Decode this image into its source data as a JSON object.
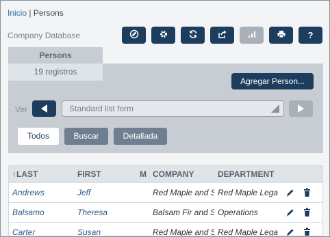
{
  "breadcrumb": {
    "home": "Inicio",
    "separator": "|",
    "current": "Persons"
  },
  "db_label": "Company Database",
  "toolbar": [
    {
      "name": "tool-button-1",
      "icon": "palette-icon",
      "disabled": false
    },
    {
      "name": "settings-button",
      "icon": "gear-icon",
      "disabled": false
    },
    {
      "name": "refresh-button",
      "icon": "refresh-icon",
      "disabled": false
    },
    {
      "name": "export-button",
      "icon": "share-icon",
      "disabled": false
    },
    {
      "name": "chart-button",
      "icon": "bar-chart-icon",
      "disabled": true
    },
    {
      "name": "print-button",
      "icon": "printer-icon",
      "disabled": false
    },
    {
      "name": "help-button",
      "icon": "question-icon",
      "label": "?",
      "disabled": false
    }
  ],
  "tab": {
    "label": "Persons",
    "count": "19 registros"
  },
  "add_button": "Agregar Person...",
  "view": {
    "label": "Ver",
    "form": "Standard list form"
  },
  "segments": [
    "Todos",
    "Buscar",
    "Detallada"
  ],
  "table": {
    "headers": [
      "↑LAST",
      "FIRST",
      "M",
      "COMPANY",
      "DEPARTMENT"
    ],
    "rows": [
      {
        "last": "Andrews",
        "first": "Jeff",
        "m": "",
        "company": "Red Maple and S",
        "department": "Red Maple Lega"
      },
      {
        "last": "Balsamo",
        "first": "Theresa",
        "m": "",
        "company": "Balsam Fir and S",
        "department": "Operations"
      },
      {
        "last": "Carter",
        "first": "Susan",
        "m": "",
        "company": "Red Maple and S",
        "department": "Red Maple Lega"
      }
    ]
  },
  "colors": {
    "primary": "#1c3d5e",
    "disabled": "#a9b0b7",
    "panel": "#c7cdd3",
    "link": "#2a6ea8"
  }
}
